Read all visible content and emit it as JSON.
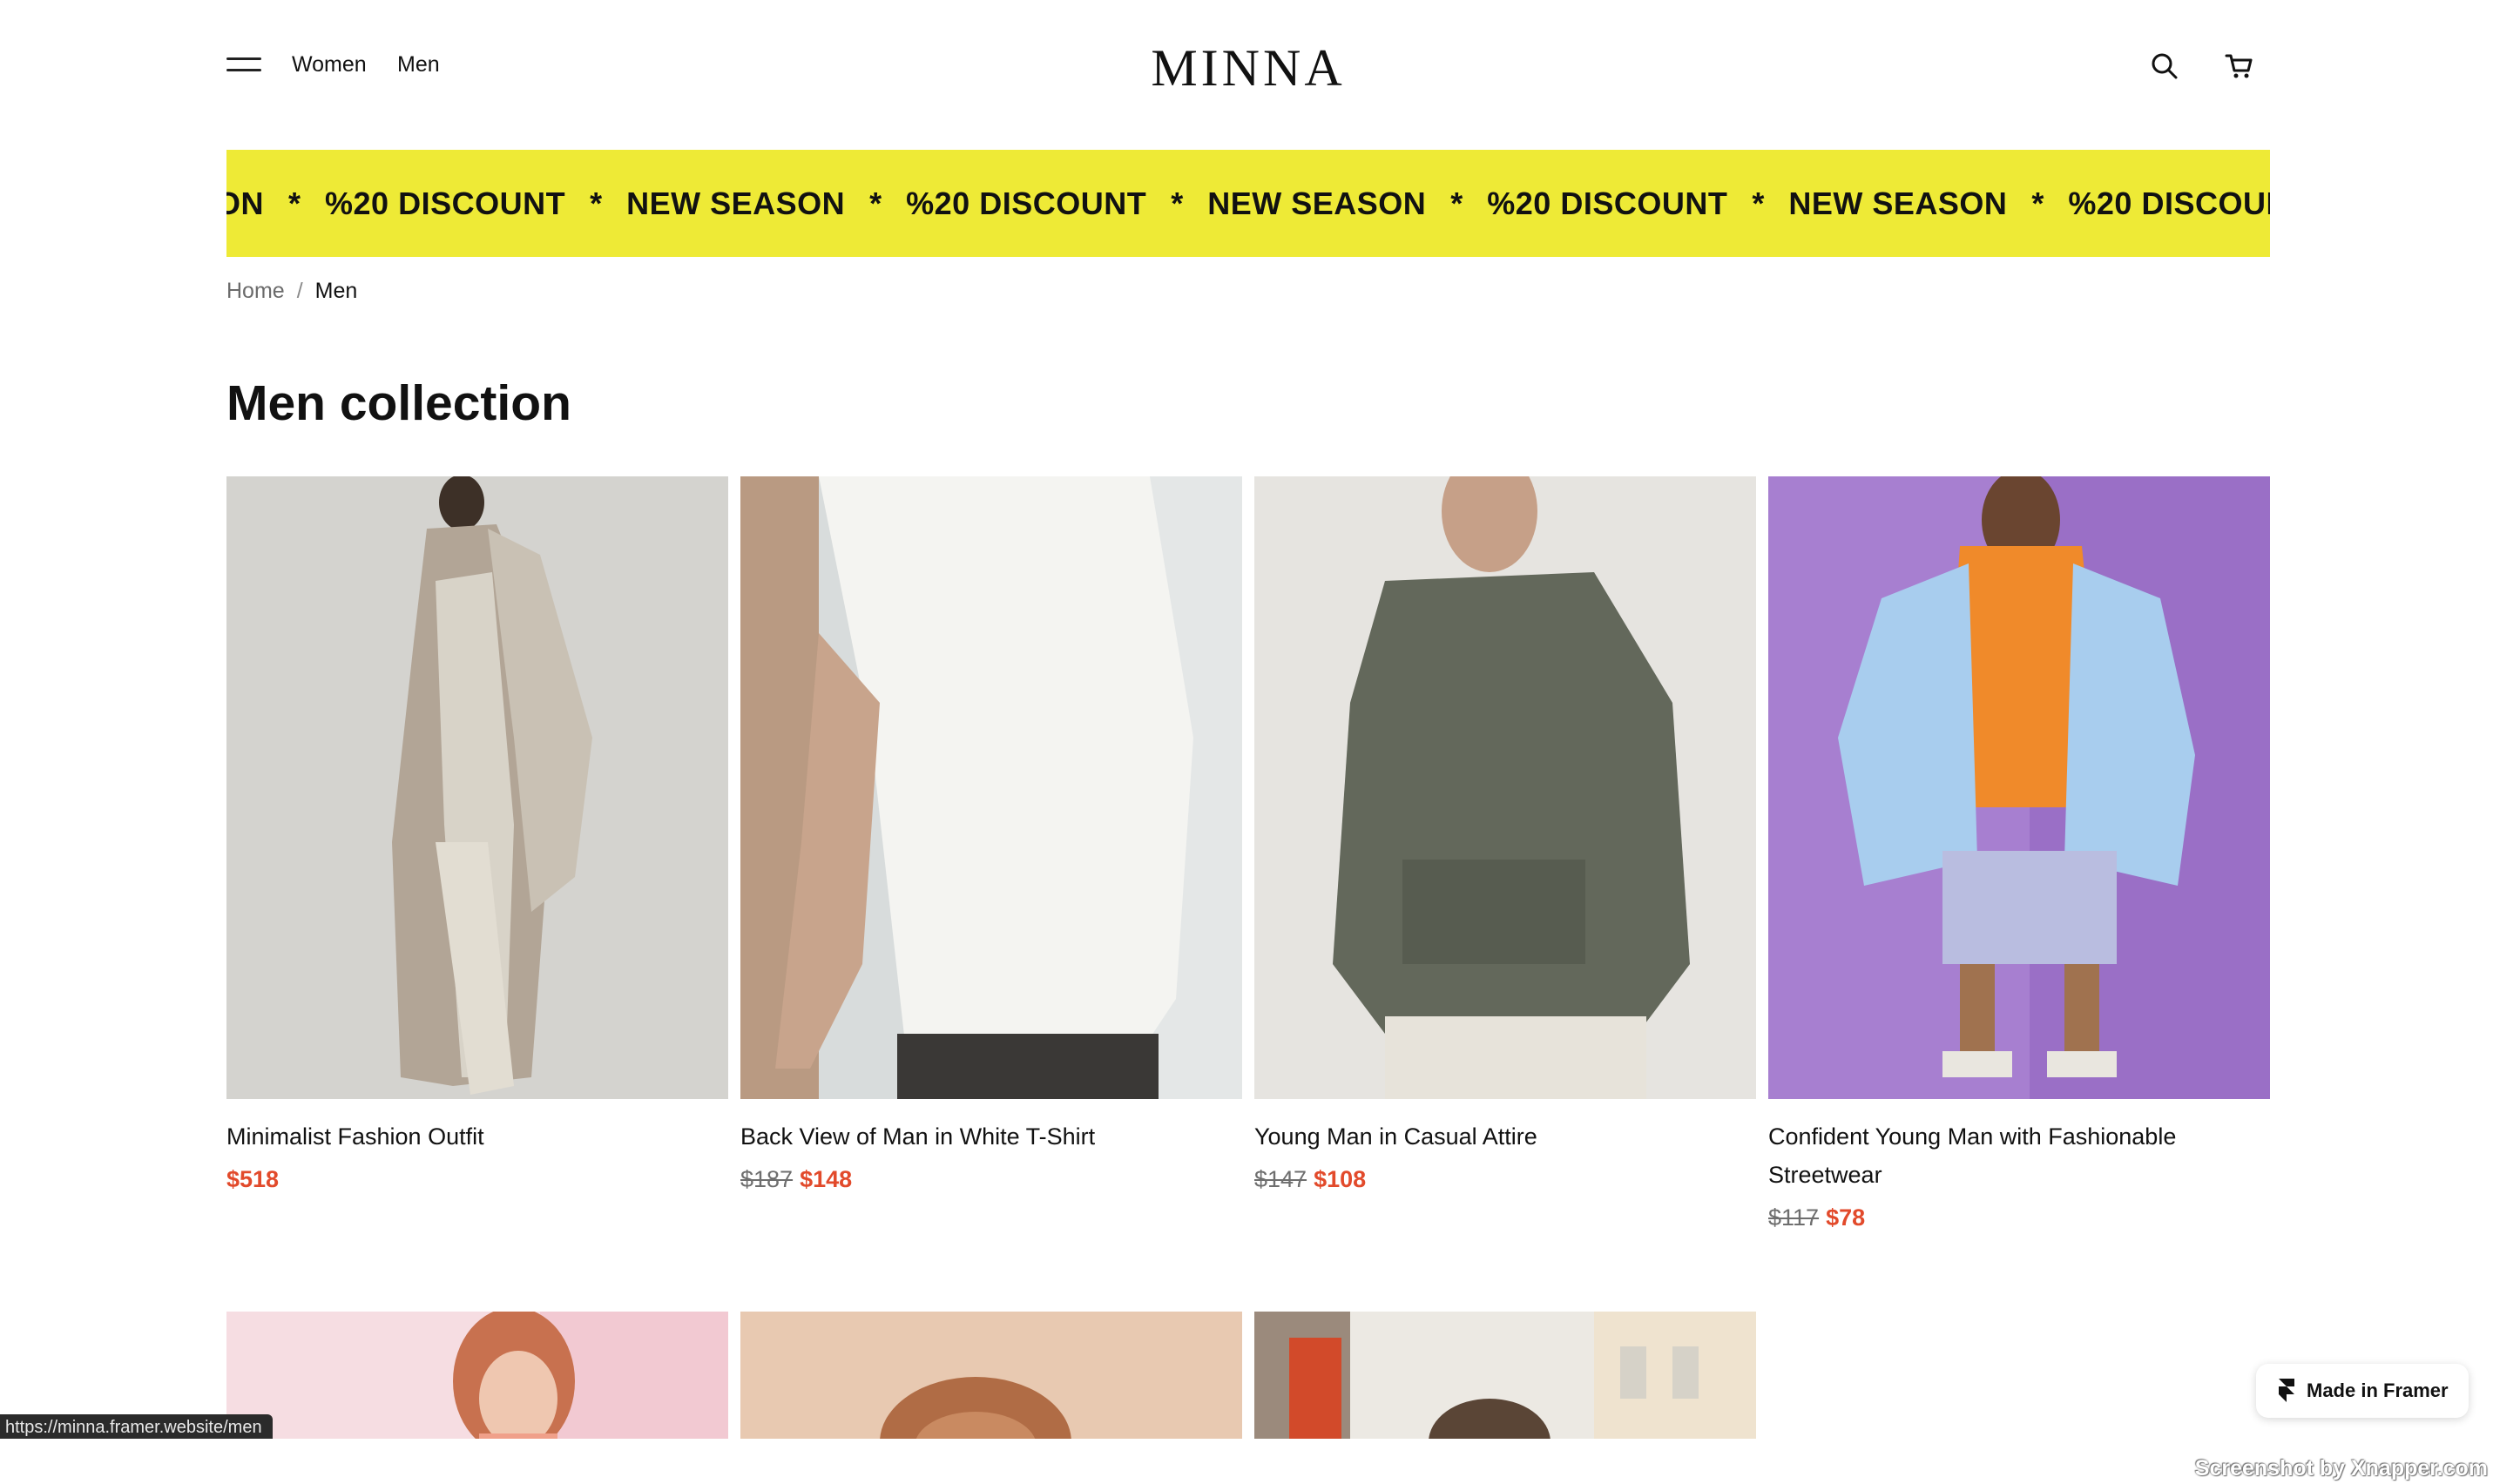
{
  "header": {
    "nav_women": "Women",
    "nav_men": "Men",
    "logo": "MINNA",
    "icons": [
      "menu-icon",
      "search-icon",
      "cart-icon"
    ]
  },
  "banner": {
    "background": "#eeea36",
    "items": [
      "ON",
      "%20 DISCOUNT",
      "NEW SEASON",
      "%20 DISCOUNT",
      "NEW SEASON",
      "%20 DISCOUNT",
      "NEW SEASON",
      "%20 DISCOUNT"
    ],
    "separator": "*"
  },
  "breadcrumb": {
    "home": "Home",
    "separator": "/",
    "current": "Men"
  },
  "page_title": "Men collection",
  "products": [
    {
      "title": "Minimalist Fashion Outfit",
      "old_price": "",
      "price": "$518"
    },
    {
      "title": "Back View of Man in White T-Shirt",
      "old_price": "$187",
      "price": "$148"
    },
    {
      "title": "Young Man in Casual Attire",
      "old_price": "$147",
      "price": "$108"
    },
    {
      "title": "Confident Young Man with Fashionable Streetwear",
      "old_price": "$117",
      "price": "$78"
    }
  ],
  "colors": {
    "accent_price": "#e24a2b",
    "banner": "#eeea36",
    "text": "#111111"
  },
  "status_url": "https://minna.framer.website/men",
  "framer_badge": "Made in Framer",
  "watermark": "Screenshot by Xnapper.com"
}
